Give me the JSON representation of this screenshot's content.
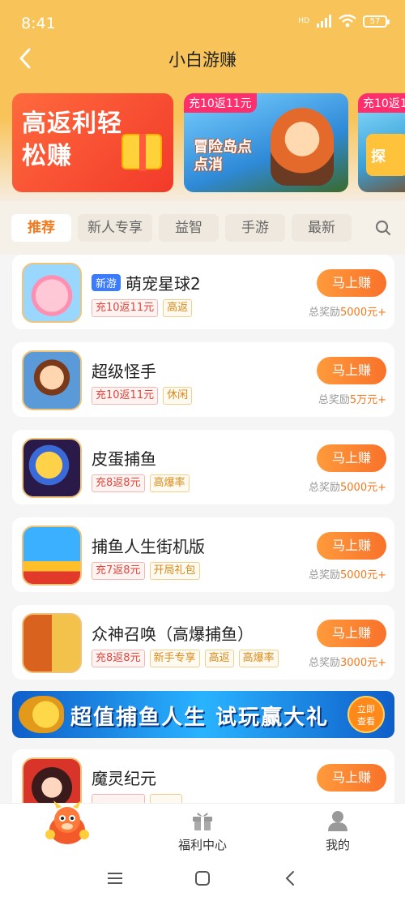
{
  "status_bar": {
    "time": "8:41",
    "network_label": "HD",
    "battery": "57"
  },
  "header": {
    "title": "小白游赚"
  },
  "banners": [
    {
      "text": "高返利轻松赚"
    },
    {
      "tag": "充10返11元",
      "art_text": "冒险岛点点消"
    },
    {
      "tag": "充10返1",
      "art_text": "探"
    }
  ],
  "tabs": [
    {
      "label": "推荐",
      "active": true
    },
    {
      "label": "新人专享",
      "active": false
    },
    {
      "label": "益智",
      "active": false
    },
    {
      "label": "手游",
      "active": false
    },
    {
      "label": "最新",
      "active": false
    }
  ],
  "games": [
    {
      "name": "萌宠星球2",
      "badge": "新游",
      "tags": [
        {
          "text": "充10返11元",
          "style": "red"
        },
        {
          "text": "高返",
          "style": "orange"
        }
      ],
      "button": "马上赚",
      "reward_prefix": "总奖励",
      "reward_amount": "5000元+",
      "icon": "pig-icon"
    },
    {
      "name": "超级怪手",
      "badge": "",
      "tags": [
        {
          "text": "充10返11元",
          "style": "red"
        },
        {
          "text": "休闲",
          "style": "orange"
        }
      ],
      "button": "马上赚",
      "reward_prefix": "总奖励",
      "reward_amount": "5万元+",
      "icon": "pirate-girl-icon"
    },
    {
      "name": "皮蛋捕鱼",
      "badge": "",
      "tags": [
        {
          "text": "充8返8元",
          "style": "red"
        },
        {
          "text": "高爆率",
          "style": "orange"
        }
      ],
      "button": "马上赚",
      "reward_prefix": "总奖励",
      "reward_amount": "5000元+",
      "icon": "cannon-pig-icon"
    },
    {
      "name": "捕鱼人生街机版",
      "badge": "",
      "tags": [
        {
          "text": "充7返8元",
          "style": "red"
        },
        {
          "text": "开局礼包",
          "style": "orange"
        }
      ],
      "button": "马上赚",
      "reward_prefix": "总奖励",
      "reward_amount": "5000元+",
      "icon": "fish-arcade-icon"
    },
    {
      "name": "众神召唤（高爆捕鱼）",
      "badge": "",
      "tags": [
        {
          "text": "充8返8元",
          "style": "red"
        },
        {
          "text": "新手专享",
          "style": "orange"
        },
        {
          "text": "高返",
          "style": "orange"
        },
        {
          "text": "高爆率",
          "style": "orange"
        }
      ],
      "button": "马上赚",
      "reward_prefix": "总奖励",
      "reward_amount": "3000元+",
      "icon": "monkey-king-icon"
    },
    {
      "name": "魔灵纪元",
      "badge": "",
      "tags": [],
      "button": "马上赚",
      "reward_prefix": "",
      "reward_amount": "",
      "icon": "demon-hero-icon"
    }
  ],
  "ad_banner": {
    "text": "超值捕鱼人生 试玩赢大礼",
    "cta": "立即查看"
  },
  "bottom_nav": [
    {
      "label": "",
      "icon": "dragon-mascot-icon"
    },
    {
      "label": "福利中心",
      "icon": "gift-icon"
    },
    {
      "label": "我的",
      "icon": "user-icon"
    }
  ],
  "colors": {
    "header": "#f8c459",
    "accent": "#f8722a",
    "tag_red": "#e2453c",
    "tag_orange": "#d98a18",
    "badge_blue": "#3a7bff"
  }
}
